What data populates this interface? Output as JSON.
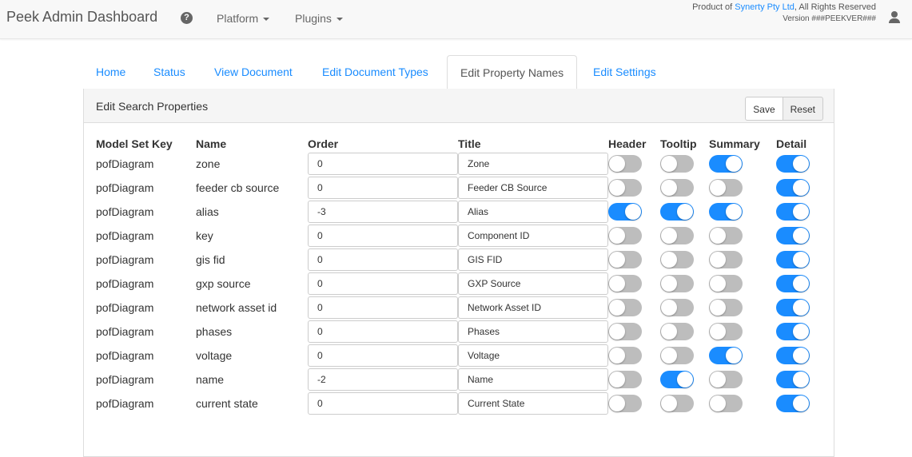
{
  "navbar": {
    "brand": "Peek Admin Dashboard",
    "menus": [
      "Platform",
      "Plugins"
    ],
    "product_prefix": "Product of ",
    "product_link": "Synerty Pty Ltd",
    "product_suffix": ", All Rights Reserved",
    "version": "Version ###PEEKVER###"
  },
  "tabs": [
    "Home",
    "Status",
    "View Document",
    "Edit Document Types",
    "Edit Property Names",
    "Edit Settings"
  ],
  "active_tab": "Edit Property Names",
  "panel": {
    "title": "Edit Search Properties",
    "save_label": "Save",
    "reset_label": "Reset"
  },
  "columns": [
    "Model Set Key",
    "Name",
    "Order",
    "Title",
    "Header",
    "Tooltip",
    "Summary",
    "Detail"
  ],
  "rows": [
    {
      "model_set_key": "pofDiagram",
      "name": "zone",
      "order": "0",
      "title": "Zone",
      "header": false,
      "tooltip": false,
      "summary": true,
      "detail": true
    },
    {
      "model_set_key": "pofDiagram",
      "name": "feeder cb source",
      "order": "0",
      "title": "Feeder CB Source",
      "header": false,
      "tooltip": false,
      "summary": false,
      "detail": true
    },
    {
      "model_set_key": "pofDiagram",
      "name": "alias",
      "order": "-3",
      "title": "Alias",
      "header": true,
      "tooltip": true,
      "summary": true,
      "detail": true
    },
    {
      "model_set_key": "pofDiagram",
      "name": "key",
      "order": "0",
      "title": "Component ID",
      "header": false,
      "tooltip": false,
      "summary": false,
      "detail": true
    },
    {
      "model_set_key": "pofDiagram",
      "name": "gis fid",
      "order": "0",
      "title": "GIS FID",
      "header": false,
      "tooltip": false,
      "summary": false,
      "detail": true
    },
    {
      "model_set_key": "pofDiagram",
      "name": "gxp source",
      "order": "0",
      "title": "GXP Source",
      "header": false,
      "tooltip": false,
      "summary": false,
      "detail": true
    },
    {
      "model_set_key": "pofDiagram",
      "name": "network asset id",
      "order": "0",
      "title": "Network Asset ID",
      "header": false,
      "tooltip": false,
      "summary": false,
      "detail": true
    },
    {
      "model_set_key": "pofDiagram",
      "name": "phases",
      "order": "0",
      "title": "Phases",
      "header": false,
      "tooltip": false,
      "summary": false,
      "detail": true
    },
    {
      "model_set_key": "pofDiagram",
      "name": "voltage",
      "order": "0",
      "title": "Voltage",
      "header": false,
      "tooltip": false,
      "summary": true,
      "detail": true
    },
    {
      "model_set_key": "pofDiagram",
      "name": "name",
      "order": "-2",
      "title": "Name",
      "header": false,
      "tooltip": true,
      "summary": false,
      "detail": true
    },
    {
      "model_set_key": "pofDiagram",
      "name": "current state",
      "order": "0",
      "title": "Current State",
      "header": false,
      "tooltip": false,
      "summary": false,
      "detail": true
    }
  ],
  "colors": {
    "accent": "#1a8cff",
    "toggle_off": "#bdbdbd"
  },
  "icons": {
    "help": "question-circle-icon",
    "user": "user-icon"
  }
}
